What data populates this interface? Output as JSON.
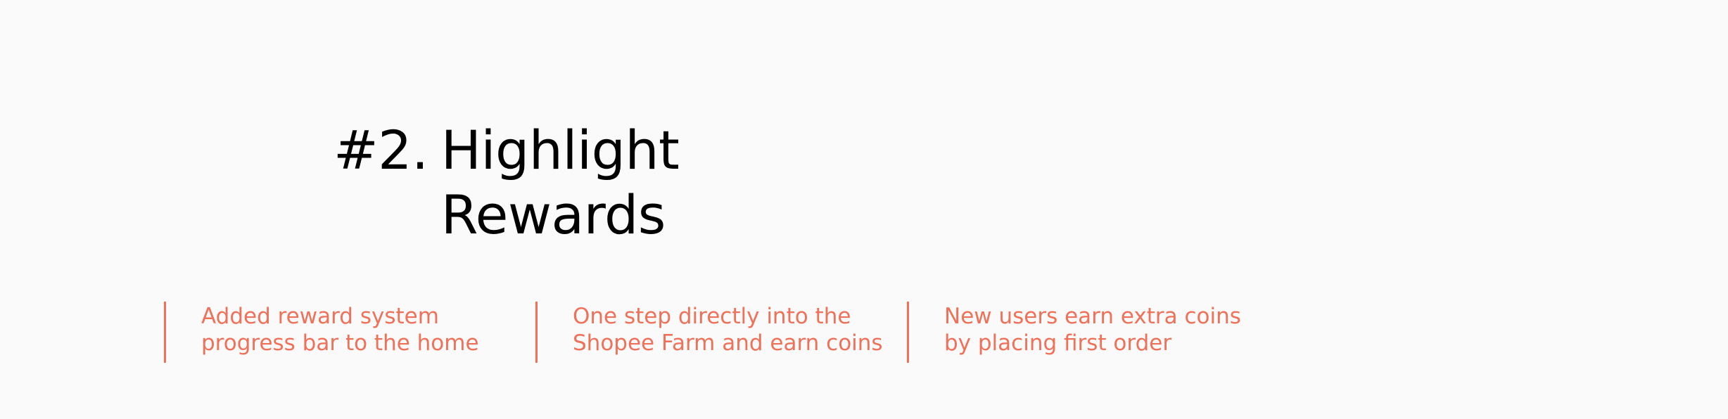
{
  "section": {
    "number": "#2.",
    "title_lines": [
      "Highlight",
      "Rewards"
    ]
  },
  "points": [
    {
      "lines": [
        "Added reward system",
        "progress bar to the home"
      ]
    },
    {
      "lines": [
        "One step directly into the",
        "Shopee Farm and earn coins"
      ]
    },
    {
      "lines": [
        "New users earn extra coins",
        "by placing first order"
      ]
    }
  ],
  "colors": {
    "background": "#fafafa",
    "title": "#000000",
    "accent": "#ef7159"
  }
}
